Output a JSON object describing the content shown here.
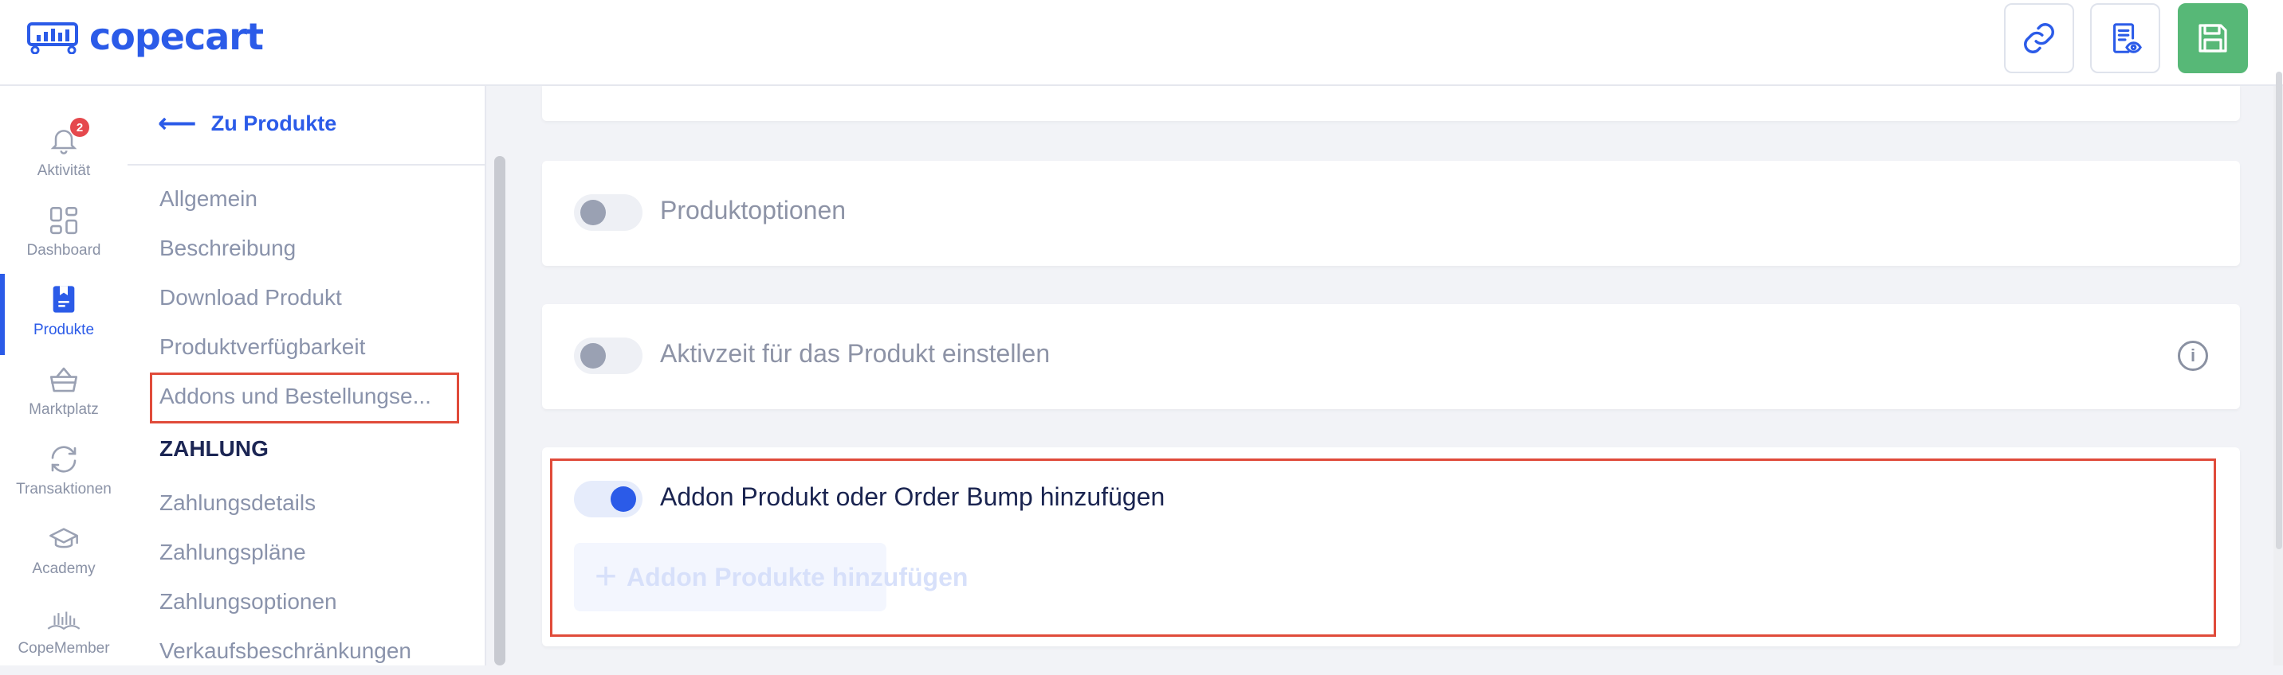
{
  "app": {
    "logo_text": "copecart",
    "brand_color": "#2b5be8",
    "header_actions": [
      {
        "name": "link-icon"
      },
      {
        "name": "preview-document-icon"
      },
      {
        "name": "save-icon"
      }
    ]
  },
  "rail": {
    "items": [
      {
        "label": "Aktivität",
        "icon": "bell-icon",
        "badge": "2"
      },
      {
        "label": "Dashboard",
        "icon": "dashboard-grid-icon"
      },
      {
        "label": "Produkte",
        "icon": "product-bookmark-icon",
        "active": true
      },
      {
        "label": "Marktplatz",
        "icon": "basket-icon"
      },
      {
        "label": "Transaktionen",
        "icon": "transactions-arrows-icon"
      },
      {
        "label": "Academy",
        "icon": "graduation-cap-icon"
      },
      {
        "label": "CopeMember",
        "icon": "library-icon"
      }
    ]
  },
  "subnav": {
    "back_label": "Zu Produkte",
    "items": [
      "Allgemein",
      "Beschreibung",
      "Download Produkt",
      "Produktverfügbarkeit",
      "Addons und Bestellungse..."
    ],
    "section_title": "ZAHLUNG",
    "section_items": [
      "Zahlungsdetails",
      "Zahlungspläne",
      "Zahlungsoptionen",
      "Verkaufsbeschränkungen"
    ]
  },
  "main": {
    "cards": [
      {
        "title": "Produktoptionen",
        "toggle_on": false
      },
      {
        "title": "Aktivzeit für das Produkt einstellen",
        "toggle_on": false,
        "info_icon": "info-icon"
      },
      {
        "title": "Addon Produkt oder Order Bump hinzufügen",
        "toggle_on": true,
        "button_label": "Addon Produkte hinzufügen"
      }
    ]
  }
}
